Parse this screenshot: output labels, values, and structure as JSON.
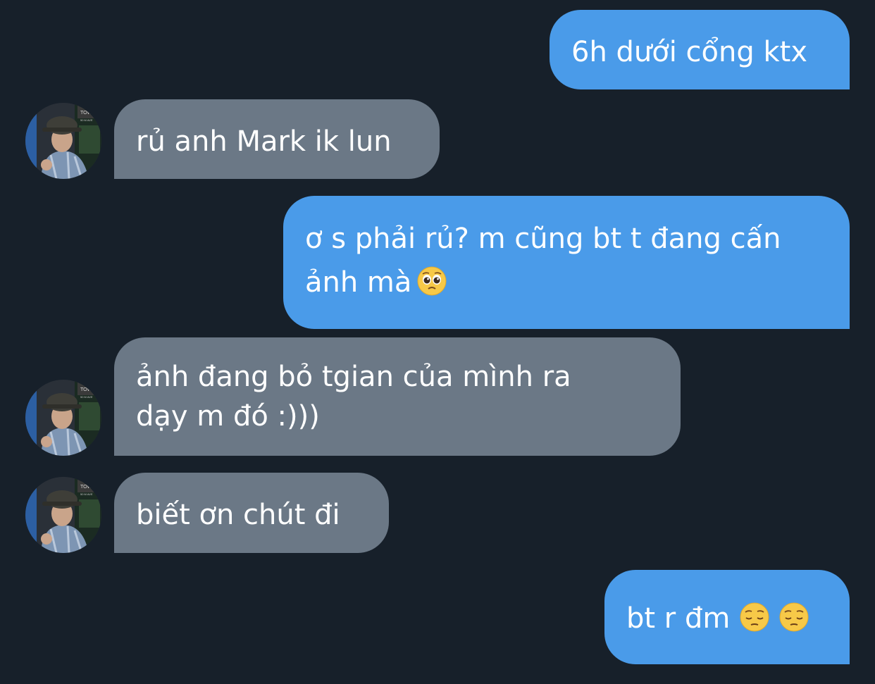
{
  "chat": {
    "messages": [
      {
        "sender": "me",
        "text": "6h dưới cổng ktx"
      },
      {
        "sender": "them",
        "text": "rủ anh Mark ik lun"
      },
      {
        "sender": "me",
        "line1": "ơ s phải rủ? m cũng bt t đang cấn",
        "line2": "ảnh mà",
        "emoji": "pleading-face"
      },
      {
        "sender": "them",
        "line1": "ảnh đang bỏ tgian của mình ra",
        "line2": "dạy m đó :)))"
      },
      {
        "sender": "them",
        "text": "biết ơn chút đi"
      },
      {
        "sender": "me",
        "text": "bt r đm",
        "emoji": [
          "pensive-face",
          "pensive-face"
        ]
      }
    ],
    "colors": {
      "background": "#17202a",
      "outgoing_bubble": "#4a9be9",
      "incoming_bubble": "#6b7886",
      "text": "#ffffff"
    }
  }
}
